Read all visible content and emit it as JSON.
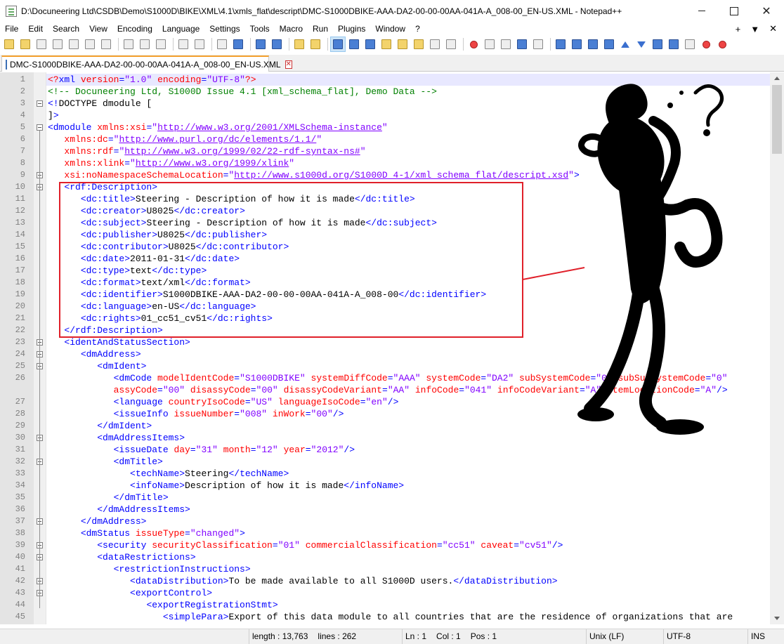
{
  "window": {
    "title": "D:\\Docuneering Ltd\\CSDB\\Demo\\S1000D\\BIKE\\XML\\4.1\\xmls_flat\\descript\\DMC-S1000DBIKE-AAA-DA2-00-00-00AA-041A-A_008-00_EN-US.XML - Notepad++",
    "minimize_glyph": "",
    "maximize_glyph": "",
    "close_glyph": "✕"
  },
  "menu": [
    "File",
    "Edit",
    "Search",
    "View",
    "Encoding",
    "Language",
    "Settings",
    "Tools",
    "Macro",
    "Run",
    "Plugins",
    "Window",
    "?"
  ],
  "menu_right": [
    "+",
    "▼",
    "✕"
  ],
  "tab": {
    "label": "DMC-S1000DBIKE-AAA-DA2-00-00-00AA-041A-A_008-00_EN-US.XML",
    "close_glyph": "✕"
  },
  "line_numbers": [
    "1",
    "2",
    "3",
    "4",
    "5",
    "6",
    "7",
    "8",
    "9",
    "10",
    "11",
    "12",
    "13",
    "14",
    "15",
    "16",
    "17",
    "18",
    "19",
    "20",
    "21",
    "22",
    "23",
    "24",
    "25",
    "26",
    "",
    "27",
    "28",
    "29",
    "30",
    "31",
    "32",
    "33",
    "34",
    "35",
    "36",
    "37",
    "38",
    "39",
    "40",
    "41",
    "42",
    "43",
    "44",
    "45"
  ],
  "code_lines": [
    [
      [
        "t-attr",
        "<?"
      ],
      [
        "t-tag",
        "xml "
      ],
      [
        "t-attr",
        "version"
      ],
      [
        "t-tag",
        "="
      ],
      [
        "t-val",
        "\"1.0\""
      ],
      [
        "t-tag",
        " "
      ],
      [
        "t-attr",
        "encoding"
      ],
      [
        "t-tag",
        "="
      ],
      [
        "t-val",
        "\"UTF-8\""
      ],
      [
        "t-attr",
        "?>"
      ]
    ],
    [
      [
        "t-com",
        "<!-- Docuneering Ltd, S1000D Issue 4.1 [xml_schema_flat], Demo Data -->"
      ]
    ],
    [
      [
        "t-tag",
        "<!"
      ],
      [
        "t-text",
        "DOCTYPE dmodule ["
      ]
    ],
    [
      [
        "t-text",
        "]"
      ],
      [
        "t-tag",
        ">"
      ]
    ],
    [
      [
        "t-tag",
        "<dmodule "
      ],
      [
        "t-attr",
        "xmlns:xsi"
      ],
      [
        "t-tag",
        "="
      ],
      [
        "t-val",
        "\""
      ],
      [
        "t-url",
        "http://www.w3.org/2001/XMLSchema-instance"
      ],
      [
        "t-val",
        "\""
      ]
    ],
    [
      [
        "t-text",
        "   "
      ],
      [
        "t-attr",
        "xmlns:dc"
      ],
      [
        "t-tag",
        "="
      ],
      [
        "t-val",
        "\""
      ],
      [
        "t-url",
        "http://www.purl.org/dc/elements/1.1/"
      ],
      [
        "t-val",
        "\""
      ]
    ],
    [
      [
        "t-text",
        "   "
      ],
      [
        "t-attr",
        "xmlns:rdf"
      ],
      [
        "t-tag",
        "="
      ],
      [
        "t-val",
        "\""
      ],
      [
        "t-url",
        "http://www.w3.org/1999/02/22-rdf-syntax-ns#"
      ],
      [
        "t-val",
        "\""
      ]
    ],
    [
      [
        "t-text",
        "   "
      ],
      [
        "t-attr",
        "xmlns:xlink"
      ],
      [
        "t-tag",
        "="
      ],
      [
        "t-val",
        "\""
      ],
      [
        "t-url",
        "http://www.w3.org/1999/xlink"
      ],
      [
        "t-val",
        "\""
      ]
    ],
    [
      [
        "t-text",
        "   "
      ],
      [
        "t-attr",
        "xsi:noNamespaceSchemaLocation"
      ],
      [
        "t-tag",
        "="
      ],
      [
        "t-val",
        "\""
      ],
      [
        "t-url",
        "http://www.s1000d.org/S1000D_4-1/xml_schema_flat/descript.xsd"
      ],
      [
        "t-val",
        "\""
      ],
      [
        "t-tag",
        ">"
      ]
    ],
    [
      [
        "t-text",
        "   "
      ],
      [
        "t-tag",
        "<rdf:Description>"
      ]
    ],
    [
      [
        "t-text",
        "      "
      ],
      [
        "t-tag",
        "<dc:title>"
      ],
      [
        "t-text",
        "Steering - Description of how it is made"
      ],
      [
        "t-tag",
        "</dc:title>"
      ]
    ],
    [
      [
        "t-text",
        "      "
      ],
      [
        "t-tag",
        "<dc:creator>"
      ],
      [
        "t-text",
        "U8025"
      ],
      [
        "t-tag",
        "</dc:creator>"
      ]
    ],
    [
      [
        "t-text",
        "      "
      ],
      [
        "t-tag",
        "<dc:subject>"
      ],
      [
        "t-text",
        "Steering - Description of how it is made"
      ],
      [
        "t-tag",
        "</dc:subject>"
      ]
    ],
    [
      [
        "t-text",
        "      "
      ],
      [
        "t-tag",
        "<dc:publisher>"
      ],
      [
        "t-text",
        "U8025"
      ],
      [
        "t-tag",
        "</dc:publisher>"
      ]
    ],
    [
      [
        "t-text",
        "      "
      ],
      [
        "t-tag",
        "<dc:contributor>"
      ],
      [
        "t-text",
        "U8025"
      ],
      [
        "t-tag",
        "</dc:contributor>"
      ]
    ],
    [
      [
        "t-text",
        "      "
      ],
      [
        "t-tag",
        "<dc:date>"
      ],
      [
        "t-text",
        "2011-01-31"
      ],
      [
        "t-tag",
        "</dc:date>"
      ]
    ],
    [
      [
        "t-text",
        "      "
      ],
      [
        "t-tag",
        "<dc:type>"
      ],
      [
        "t-text",
        "text"
      ],
      [
        "t-tag",
        "</dc:type>"
      ]
    ],
    [
      [
        "t-text",
        "      "
      ],
      [
        "t-tag",
        "<dc:format>"
      ],
      [
        "t-text",
        "text/xml"
      ],
      [
        "t-tag",
        "</dc:format>"
      ]
    ],
    [
      [
        "t-text",
        "      "
      ],
      [
        "t-tag",
        "<dc:identifier>"
      ],
      [
        "t-text",
        "S1000DBIKE-AAA-DA2-00-00-00AA-041A-A_008-00"
      ],
      [
        "t-tag",
        "</dc:identifier>"
      ]
    ],
    [
      [
        "t-text",
        "      "
      ],
      [
        "t-tag",
        "<dc:language>"
      ],
      [
        "t-text",
        "en-US"
      ],
      [
        "t-tag",
        "</dc:language>"
      ]
    ],
    [
      [
        "t-text",
        "      "
      ],
      [
        "t-tag",
        "<dc:rights>"
      ],
      [
        "t-text",
        "01_cc51_cv51"
      ],
      [
        "t-tag",
        "</dc:rights>"
      ]
    ],
    [
      [
        "t-text",
        "   "
      ],
      [
        "t-tag",
        "</rdf:Description>"
      ]
    ],
    [
      [
        "t-text",
        "   "
      ],
      [
        "t-tag",
        "<identAndStatusSection>"
      ]
    ],
    [
      [
        "t-text",
        "      "
      ],
      [
        "t-tag",
        "<dmAddress>"
      ]
    ],
    [
      [
        "t-text",
        "         "
      ],
      [
        "t-tag",
        "<dmIdent>"
      ]
    ],
    [
      [
        "t-text",
        "            "
      ],
      [
        "t-tag",
        "<dmCode "
      ],
      [
        "t-attr",
        "modelIdentCode"
      ],
      [
        "t-tag",
        "="
      ],
      [
        "t-val",
        "\"S1000DBIKE\""
      ],
      [
        "t-tag",
        " "
      ],
      [
        "t-attr",
        "systemDiffCode"
      ],
      [
        "t-tag",
        "="
      ],
      [
        "t-val",
        "\"AAA\""
      ],
      [
        "t-tag",
        " "
      ],
      [
        "t-attr",
        "systemCode"
      ],
      [
        "t-tag",
        "="
      ],
      [
        "t-val",
        "\"DA2\""
      ],
      [
        "t-tag",
        " "
      ],
      [
        "t-attr",
        "subSystemCode"
      ],
      [
        "t-tag",
        "="
      ],
      [
        "t-val",
        "\"0\""
      ],
      [
        "t-tag",
        " "
      ],
      [
        "t-attr",
        "subSubSystemCode"
      ],
      [
        "t-tag",
        "="
      ],
      [
        "t-val",
        "\"0\""
      ]
    ],
    [
      [
        "t-text",
        "            "
      ],
      [
        "t-attr",
        "assyCode"
      ],
      [
        "t-tag",
        "="
      ],
      [
        "t-val",
        "\"00\""
      ],
      [
        "t-tag",
        " "
      ],
      [
        "t-attr",
        "disassyCode"
      ],
      [
        "t-tag",
        "="
      ],
      [
        "t-val",
        "\"00\""
      ],
      [
        "t-tag",
        " "
      ],
      [
        "t-attr",
        "disassyCodeVariant"
      ],
      [
        "t-tag",
        "="
      ],
      [
        "t-val",
        "\"AA\""
      ],
      [
        "t-tag",
        " "
      ],
      [
        "t-attr",
        "infoCode"
      ],
      [
        "t-tag",
        "="
      ],
      [
        "t-val",
        "\"041\""
      ],
      [
        "t-tag",
        " "
      ],
      [
        "t-attr",
        "infoCodeVariant"
      ],
      [
        "t-tag",
        "="
      ],
      [
        "t-val",
        "\"A\""
      ],
      [
        "t-tag",
        " "
      ],
      [
        "t-attr",
        "itemLocationCode"
      ],
      [
        "t-tag",
        "="
      ],
      [
        "t-val",
        "\"A\""
      ],
      [
        "t-tag",
        "/>"
      ]
    ],
    [
      [
        "t-text",
        "            "
      ],
      [
        "t-tag",
        "<language "
      ],
      [
        "t-attr",
        "countryIsoCode"
      ],
      [
        "t-tag",
        "="
      ],
      [
        "t-val",
        "\"US\""
      ],
      [
        "t-tag",
        " "
      ],
      [
        "t-attr",
        "languageIsoCode"
      ],
      [
        "t-tag",
        "="
      ],
      [
        "t-val",
        "\"en\""
      ],
      [
        "t-tag",
        "/>"
      ]
    ],
    [
      [
        "t-text",
        "            "
      ],
      [
        "t-tag",
        "<issueInfo "
      ],
      [
        "t-attr",
        "issueNumber"
      ],
      [
        "t-tag",
        "="
      ],
      [
        "t-val",
        "\"008\""
      ],
      [
        "t-tag",
        " "
      ],
      [
        "t-attr",
        "inWork"
      ],
      [
        "t-tag",
        "="
      ],
      [
        "t-val",
        "\"00\""
      ],
      [
        "t-tag",
        "/>"
      ]
    ],
    [
      [
        "t-text",
        "         "
      ],
      [
        "t-tag",
        "</dmIdent>"
      ]
    ],
    [
      [
        "t-text",
        "         "
      ],
      [
        "t-tag",
        "<dmAddressItems>"
      ]
    ],
    [
      [
        "t-text",
        "            "
      ],
      [
        "t-tag",
        "<issueDate "
      ],
      [
        "t-attr",
        "day"
      ],
      [
        "t-tag",
        "="
      ],
      [
        "t-val",
        "\"31\""
      ],
      [
        "t-tag",
        " "
      ],
      [
        "t-attr",
        "month"
      ],
      [
        "t-tag",
        "="
      ],
      [
        "t-val",
        "\"12\""
      ],
      [
        "t-tag",
        " "
      ],
      [
        "t-attr",
        "year"
      ],
      [
        "t-tag",
        "="
      ],
      [
        "t-val",
        "\"2012\""
      ],
      [
        "t-tag",
        "/>"
      ]
    ],
    [
      [
        "t-text",
        "            "
      ],
      [
        "t-tag",
        "<dmTitle>"
      ]
    ],
    [
      [
        "t-text",
        "               "
      ],
      [
        "t-tag",
        "<techName>"
      ],
      [
        "t-text",
        "Steering"
      ],
      [
        "t-tag",
        "</techName>"
      ]
    ],
    [
      [
        "t-text",
        "               "
      ],
      [
        "t-tag",
        "<infoName>"
      ],
      [
        "t-text",
        "Description of how it is made"
      ],
      [
        "t-tag",
        "</infoName>"
      ]
    ],
    [
      [
        "t-text",
        "            "
      ],
      [
        "t-tag",
        "</dmTitle>"
      ]
    ],
    [
      [
        "t-text",
        "         "
      ],
      [
        "t-tag",
        "</dmAddressItems>"
      ]
    ],
    [
      [
        "t-text",
        "      "
      ],
      [
        "t-tag",
        "</dmAddress>"
      ]
    ],
    [
      [
        "t-text",
        "      "
      ],
      [
        "t-tag",
        "<dmStatus "
      ],
      [
        "t-attr",
        "issueType"
      ],
      [
        "t-tag",
        "="
      ],
      [
        "t-val",
        "\"changed\""
      ],
      [
        "t-tag",
        ">"
      ]
    ],
    [
      [
        "t-text",
        "         "
      ],
      [
        "t-tag",
        "<security "
      ],
      [
        "t-attr",
        "securityClassification"
      ],
      [
        "t-tag",
        "="
      ],
      [
        "t-val",
        "\"01\""
      ],
      [
        "t-tag",
        " "
      ],
      [
        "t-attr",
        "commercialClassification"
      ],
      [
        "t-tag",
        "="
      ],
      [
        "t-val",
        "\"cc51\""
      ],
      [
        "t-tag",
        " "
      ],
      [
        "t-attr",
        "caveat"
      ],
      [
        "t-tag",
        "="
      ],
      [
        "t-val",
        "\"cv51\""
      ],
      [
        "t-tag",
        "/>"
      ]
    ],
    [
      [
        "t-text",
        "         "
      ],
      [
        "t-tag",
        "<dataRestrictions>"
      ]
    ],
    [
      [
        "t-text",
        "            "
      ],
      [
        "t-tag",
        "<restrictionInstructions>"
      ]
    ],
    [
      [
        "t-text",
        "               "
      ],
      [
        "t-tag",
        "<dataDistribution>"
      ],
      [
        "t-text",
        "To be made available to all S1000D users."
      ],
      [
        "t-tag",
        "</dataDistribution>"
      ]
    ],
    [
      [
        "t-text",
        "               "
      ],
      [
        "t-tag",
        "<exportControl>"
      ]
    ],
    [
      [
        "t-text",
        "                  "
      ],
      [
        "t-tag",
        "<exportRegistrationStmt>"
      ]
    ],
    [
      [
        "t-text",
        "                     "
      ],
      [
        "t-tag",
        "<simplePara>"
      ],
      [
        "t-text",
        "Export of this data module to all countries that are the residence of organizations that are"
      ]
    ]
  ],
  "status": {
    "length": "length : 13,763",
    "lines": "lines : 262",
    "ln": "Ln : 1",
    "col": "Col : 1",
    "pos": "Pos : 1",
    "eol": "Unix (LF)",
    "encoding": "UTF-8",
    "mode": "INS"
  }
}
